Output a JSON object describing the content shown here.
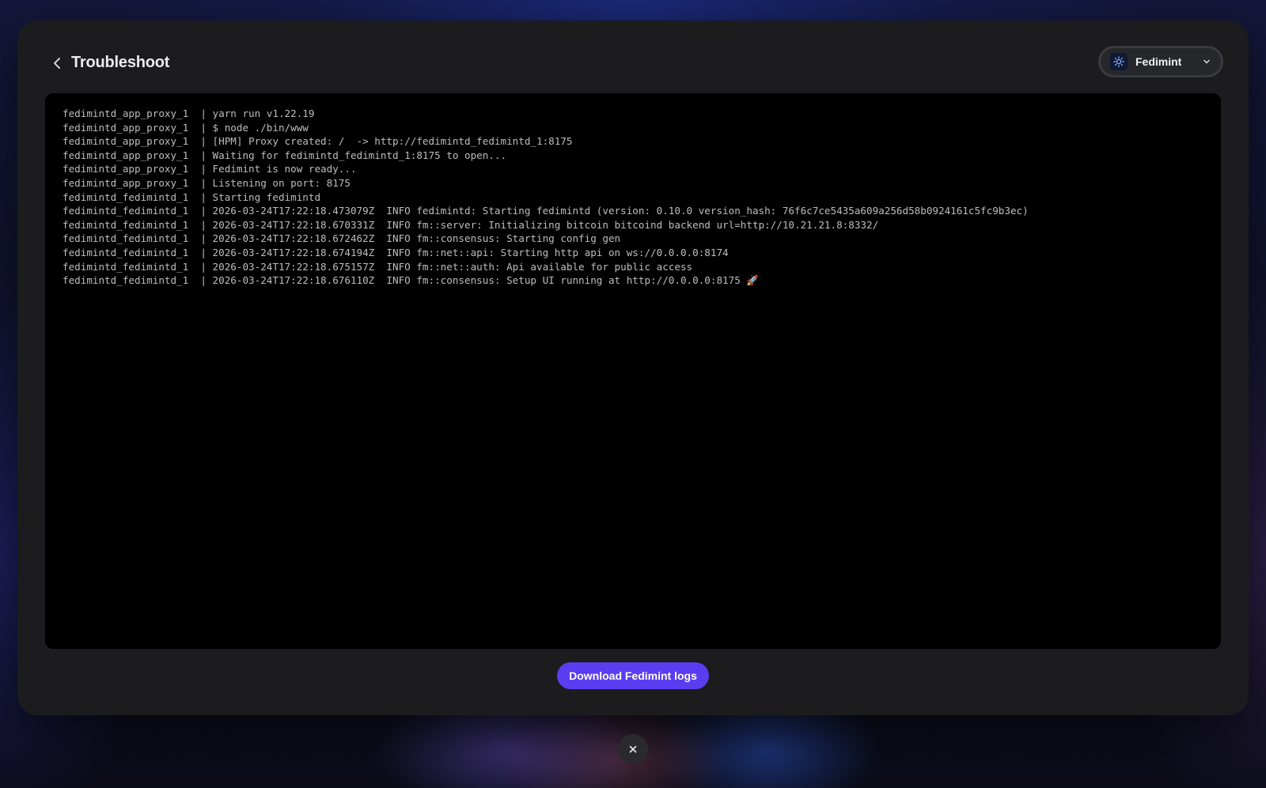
{
  "header": {
    "title": "Troubleshoot",
    "back_icon": "chevron-left-icon"
  },
  "app_selector": {
    "selected": "Fedimint",
    "icon": "fedimint-icon",
    "dropdown_icon": "chevron-down-icon"
  },
  "logs": [
    "fedimintd_app_proxy_1  | yarn run v1.22.19",
    "fedimintd_app_proxy_1  | $ node ./bin/www",
    "fedimintd_app_proxy_1  | [HPM] Proxy created: /  -> http://fedimintd_fedimintd_1:8175",
    "fedimintd_app_proxy_1  | Waiting for fedimintd_fedimintd_1:8175 to open...",
    "fedimintd_app_proxy_1  | Fedimint is now ready...",
    "fedimintd_app_proxy_1  | Listening on port: 8175",
    "fedimintd_fedimintd_1  | Starting fedimintd",
    "fedimintd_fedimintd_1  | 2026-03-24T17:22:18.473079Z  INFO fedimintd: Starting fedimintd (version: 0.10.0 version_hash: 76f6c7ce5435a609a256d58b0924161c5fc9b3ec)",
    "fedimintd_fedimintd_1  | 2026-03-24T17:22:18.670331Z  INFO fm::server: Initializing bitcoin bitcoind backend url=http://10.21.21.8:8332/",
    "fedimintd_fedimintd_1  | 2026-03-24T17:22:18.672462Z  INFO fm::consensus: Starting config gen",
    "fedimintd_fedimintd_1  | 2026-03-24T17:22:18.674194Z  INFO fm::net::api: Starting http api on ws://0.0.0.0:8174",
    "fedimintd_fedimintd_1  | 2026-03-24T17:22:18.675157Z  INFO fm::net::auth: Api available for public access",
    "fedimintd_fedimintd_1  | 2026-03-24T17:22:18.676110Z  INFO fm::consensus: Setup UI running at http://0.0.0.0:8175 🚀"
  ],
  "actions": {
    "download_label": "Download Fedimint logs",
    "close_icon": "close-icon"
  },
  "colors": {
    "accent": "#5a3df0",
    "panel": "#1c1c1e",
    "terminal_bg": "#000000",
    "terminal_text": "#bdbdbd"
  }
}
